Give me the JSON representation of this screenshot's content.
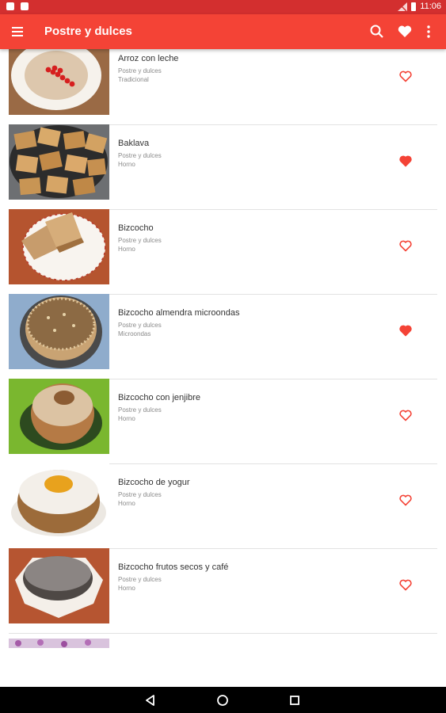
{
  "status_bar": {
    "time": "11:06"
  },
  "app_bar": {
    "title": "Postre y dulces"
  },
  "recipes": [
    {
      "name": "Arroz con leche",
      "category": "Postre y dulces",
      "method": "Tradicional",
      "favorite": false
    },
    {
      "name": "Baklava",
      "category": "Postre y dulces",
      "method": "Horno",
      "favorite": true
    },
    {
      "name": "Bizcocho",
      "category": "Postre y dulces",
      "method": "Horno",
      "favorite": false
    },
    {
      "name": "Bizcocho almendra microondas",
      "category": "Postre y dulces",
      "method": "Microondas",
      "favorite": true
    },
    {
      "name": "Bizcocho con jenjibre",
      "category": "Postre y dulces",
      "method": "Horno",
      "favorite": false
    },
    {
      "name": "Bizcocho de yogur",
      "category": "Postre y dulces",
      "method": "Horno",
      "favorite": false
    },
    {
      "name": "Bizcocho frutos secos y café",
      "category": "Postre y dulces",
      "method": "Horno",
      "favorite": false
    }
  ],
  "colors": {
    "app_bar": "#f44336",
    "status_bar": "#d32f2f",
    "favorite": "#f44336"
  },
  "icons": {
    "menu": "menu-icon",
    "search": "search-icon",
    "favorites": "heart-icon",
    "overflow": "more-vert-icon"
  }
}
